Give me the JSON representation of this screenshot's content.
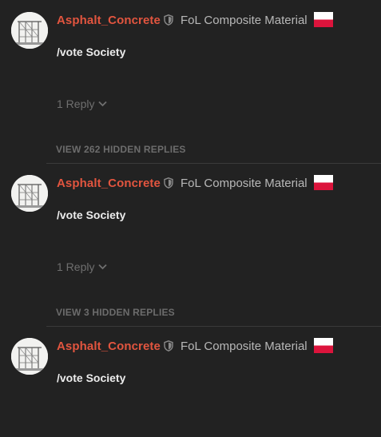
{
  "comments": [
    {
      "username": "Asphalt_Concrete",
      "flair": "FoL Composite Material",
      "body": "/vote Society",
      "reply_label": "1 Reply"
    },
    {
      "username": "Asphalt_Concrete",
      "flair": "FoL Composite Material",
      "body": "/vote Society",
      "reply_label": "1 Reply"
    },
    {
      "username": "Asphalt_Concrete",
      "flair": "FoL Composite Material",
      "body": "/vote Society"
    }
  ],
  "hidden_replies": [
    "VIEW 262 HIDDEN REPLIES",
    "VIEW 3 HIDDEN REPLIES"
  ],
  "colors": {
    "background": "#222222",
    "username": "#e2553f",
    "flair": "#b8b8b8",
    "body": "#ececec",
    "muted": "#6f6f6f",
    "flag_white": "#ffffff",
    "flag_red": "#dc143c"
  },
  "icons": {
    "avatar": "avatar-image",
    "badge": "shield-icon",
    "flag": "flag-poland-icon",
    "expand": "chevron-down-icon"
  }
}
